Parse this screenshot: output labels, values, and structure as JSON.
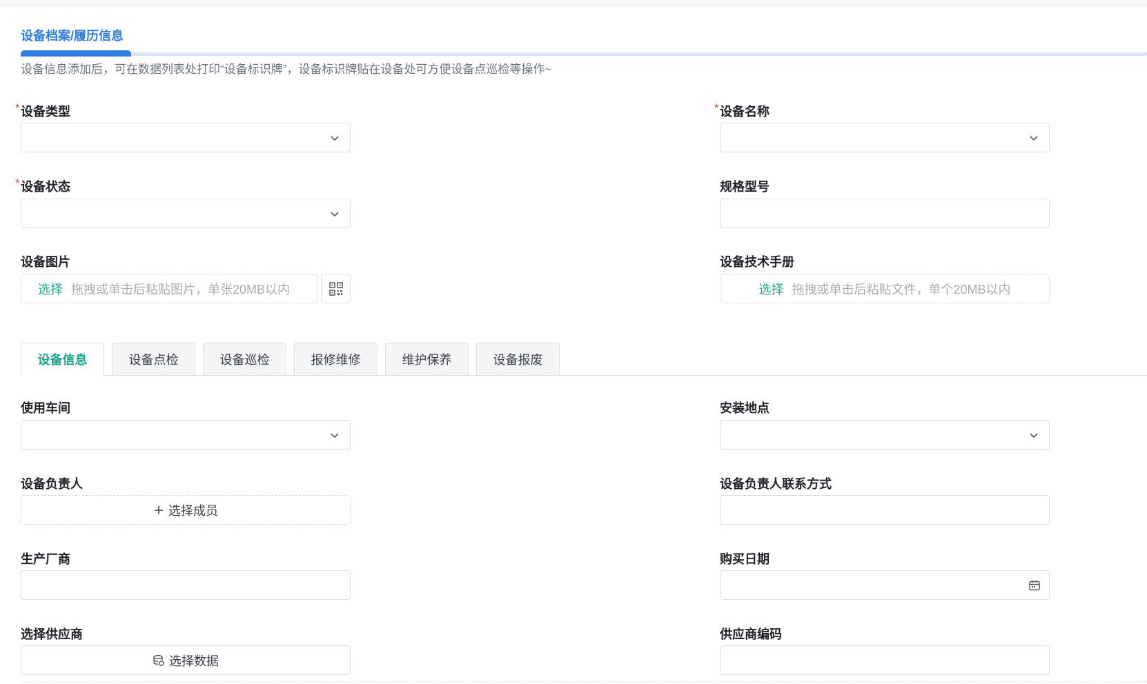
{
  "section": {
    "title": "设备档案/履历信息",
    "hint": "设备信息添加后，可在数据列表处打印“设备标识牌”，设备标识牌贴在设备处可方便设备点巡检等操作~"
  },
  "form": {
    "device_type_label": "设备类型",
    "device_name_label": "设备名称",
    "device_status_label": "设备状态",
    "spec_model_label": "规格型号",
    "device_image_label": "设备图片",
    "device_manual_label": "设备技术手册",
    "image_upload": {
      "pick": "选择",
      "placeholder": "拖拽或单击后粘贴图片，单张20MB以内"
    },
    "manual_upload": {
      "pick": "选择",
      "placeholder": "拖拽或单击后粘贴文件，单个20MB以内"
    },
    "required_mark": "*"
  },
  "tabs": [
    {
      "label": "设备信息",
      "active": true
    },
    {
      "label": "设备点检",
      "active": false
    },
    {
      "label": "设备巡检",
      "active": false
    },
    {
      "label": "报修维修",
      "active": false
    },
    {
      "label": "维护保养",
      "active": false
    },
    {
      "label": "设备报废",
      "active": false
    }
  ],
  "info": {
    "workshop_label": "使用车间",
    "location_label": "安装地点",
    "owner_label": "设备负责人",
    "owner_button": "选择成员",
    "owner_contact_label": "设备负责人联系方式",
    "manufacturer_label": "生产厂商",
    "purchase_date_label": "购买日期",
    "supplier_label": "选择供应商",
    "supplier_button": "选择数据",
    "supplier_code_label": "供应商编码"
  },
  "colors": {
    "accent_blue": "#2f7ee0",
    "accent_green": "#19a58a",
    "required_red": "#e0453a"
  },
  "icons": [
    "chevron-down-icon",
    "qrcode-icon",
    "plus-icon",
    "database-icon",
    "calendar-icon"
  ]
}
